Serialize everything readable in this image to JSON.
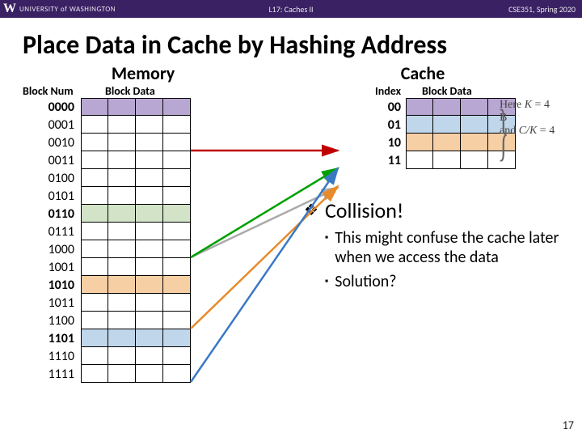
{
  "topbar": {
    "uw_w": "W",
    "uw_text": "UNIVERSITY of WASHINGTON",
    "lecture": "L17: Caches II",
    "course": "CSE351, Spring 2020"
  },
  "title": "Place Data in Cache by Hashing Address",
  "headers": {
    "memory": "Memory",
    "cache": "Cache",
    "block_num": "Block Num",
    "block_data": "Block Data",
    "index": "Index"
  },
  "memory_rows": [
    {
      "num": "0000",
      "color": "purple",
      "bold": true
    },
    {
      "num": "0001",
      "color": "",
      "bold": false
    },
    {
      "num": "0010",
      "color": "",
      "bold": false
    },
    {
      "num": "0011",
      "color": "",
      "bold": false
    },
    {
      "num": "0100",
      "color": "",
      "bold": false
    },
    {
      "num": "0101",
      "color": "",
      "bold": false
    },
    {
      "num": "0110",
      "color": "green",
      "bold": true
    },
    {
      "num": "0111",
      "color": "",
      "bold": false
    },
    {
      "num": "1000",
      "color": "",
      "bold": false
    },
    {
      "num": "1001",
      "color": "",
      "bold": false
    },
    {
      "num": "1010",
      "color": "orange",
      "bold": true
    },
    {
      "num": "1011",
      "color": "",
      "bold": false
    },
    {
      "num": "1100",
      "color": "",
      "bold": false
    },
    {
      "num": "1101",
      "color": "blue",
      "bold": true
    },
    {
      "num": "1110",
      "color": "",
      "bold": false
    },
    {
      "num": "1111",
      "color": "",
      "bold": false
    }
  ],
  "cache_rows": [
    {
      "idx": "00",
      "color": "purple"
    },
    {
      "idx": "01",
      "color": "blue"
    },
    {
      "idx": "10",
      "color": "orange"
    },
    {
      "idx": "11",
      "color": ""
    }
  ],
  "anno": {
    "line1_pre": "Here ",
    "line1_k": "K",
    "line1_eq": " = 4 B",
    "line2_pre": "and ",
    "line2_ck": "C/K",
    "line2_eq": " = 4"
  },
  "bullets": {
    "b1_mark": "❖",
    "b1": "Collision!",
    "s1_mark": "▪",
    "s1": "This might confuse the cache later when we access the data",
    "s2_mark": "▪",
    "s2": "Solution?"
  },
  "page": "17"
}
